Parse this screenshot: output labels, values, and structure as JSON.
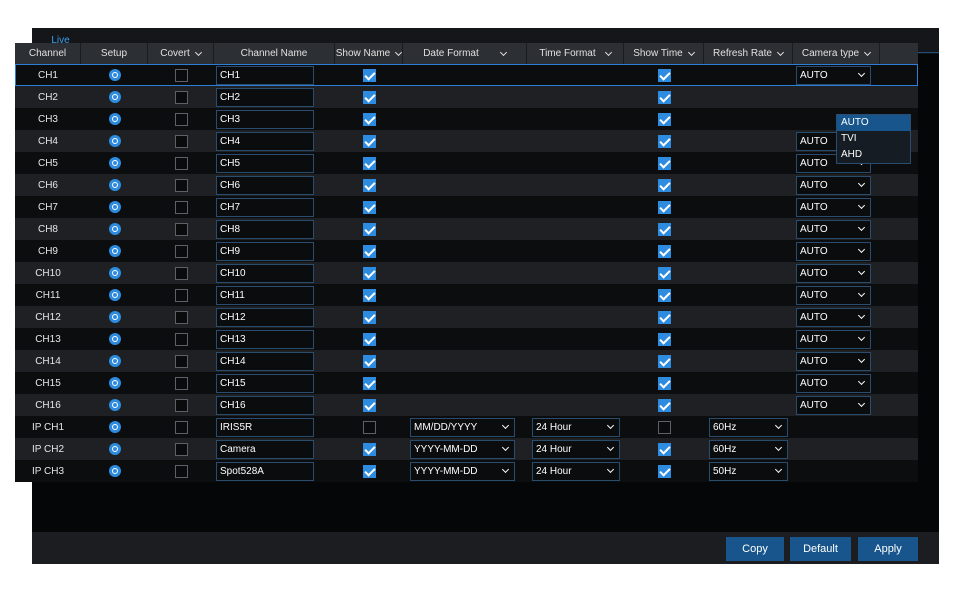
{
  "tabs": [
    {
      "label": "Live",
      "active": true
    }
  ],
  "columns": {
    "channel": "Channel",
    "setup": "Setup",
    "covert": "Covert",
    "channel_name": "Channel Name",
    "show_name": "Show Name",
    "date_format": "Date Format",
    "time_format": "Time Format",
    "show_time": "Show Time",
    "refresh_rate": "Refresh Rate",
    "camera_type": "Camera type"
  },
  "rows": [
    {
      "channel": "CH1",
      "covert": false,
      "name": "CH1",
      "show_name": true,
      "date_format": "",
      "time_format": "",
      "show_time": true,
      "refresh_rate": "",
      "camera_type": "AUTO",
      "selected": true
    },
    {
      "channel": "CH2",
      "covert": false,
      "name": "CH2",
      "show_name": true,
      "date_format": "",
      "time_format": "",
      "show_time": true,
      "refresh_rate": "",
      "camera_type": ""
    },
    {
      "channel": "CH3",
      "covert": false,
      "name": "CH3",
      "show_name": true,
      "date_format": "",
      "time_format": "",
      "show_time": true,
      "refresh_rate": "",
      "camera_type": ""
    },
    {
      "channel": "CH4",
      "covert": false,
      "name": "CH4",
      "show_name": true,
      "date_format": "",
      "time_format": "",
      "show_time": true,
      "refresh_rate": "",
      "camera_type": "AUTO"
    },
    {
      "channel": "CH5",
      "covert": false,
      "name": "CH5",
      "show_name": true,
      "date_format": "",
      "time_format": "",
      "show_time": true,
      "refresh_rate": "",
      "camera_type": "AUTO"
    },
    {
      "channel": "CH6",
      "covert": false,
      "name": "CH6",
      "show_name": true,
      "date_format": "",
      "time_format": "",
      "show_time": true,
      "refresh_rate": "",
      "camera_type": "AUTO"
    },
    {
      "channel": "CH7",
      "covert": false,
      "name": "CH7",
      "show_name": true,
      "date_format": "",
      "time_format": "",
      "show_time": true,
      "refresh_rate": "",
      "camera_type": "AUTO"
    },
    {
      "channel": "CH8",
      "covert": false,
      "name": "CH8",
      "show_name": true,
      "date_format": "",
      "time_format": "",
      "show_time": true,
      "refresh_rate": "",
      "camera_type": "AUTO"
    },
    {
      "channel": "CH9",
      "covert": false,
      "name": "CH9",
      "show_name": true,
      "date_format": "",
      "time_format": "",
      "show_time": true,
      "refresh_rate": "",
      "camera_type": "AUTO"
    },
    {
      "channel": "CH10",
      "covert": false,
      "name": "CH10",
      "show_name": true,
      "date_format": "",
      "time_format": "",
      "show_time": true,
      "refresh_rate": "",
      "camera_type": "AUTO"
    },
    {
      "channel": "CH11",
      "covert": false,
      "name": "CH11",
      "show_name": true,
      "date_format": "",
      "time_format": "",
      "show_time": true,
      "refresh_rate": "",
      "camera_type": "AUTO"
    },
    {
      "channel": "CH12",
      "covert": false,
      "name": "CH12",
      "show_name": true,
      "date_format": "",
      "time_format": "",
      "show_time": true,
      "refresh_rate": "",
      "camera_type": "AUTO"
    },
    {
      "channel": "CH13",
      "covert": false,
      "name": "CH13",
      "show_name": true,
      "date_format": "",
      "time_format": "",
      "show_time": true,
      "refresh_rate": "",
      "camera_type": "AUTO"
    },
    {
      "channel": "CH14",
      "covert": false,
      "name": "CH14",
      "show_name": true,
      "date_format": "",
      "time_format": "",
      "show_time": true,
      "refresh_rate": "",
      "camera_type": "AUTO"
    },
    {
      "channel": "CH15",
      "covert": false,
      "name": "CH15",
      "show_name": true,
      "date_format": "",
      "time_format": "",
      "show_time": true,
      "refresh_rate": "",
      "camera_type": "AUTO"
    },
    {
      "channel": "CH16",
      "covert": false,
      "name": "CH16",
      "show_name": true,
      "date_format": "",
      "time_format": "",
      "show_time": true,
      "refresh_rate": "",
      "camera_type": "AUTO"
    },
    {
      "channel": "IP CH1",
      "covert": false,
      "name": "IRIS5R",
      "show_name": false,
      "date_format": "MM/DD/YYYY",
      "time_format": "24 Hour",
      "show_time": false,
      "refresh_rate": "60Hz",
      "camera_type": ""
    },
    {
      "channel": "IP CH2",
      "covert": false,
      "name": "Camera",
      "show_name": true,
      "date_format": "YYYY-MM-DD",
      "time_format": "24 Hour",
      "show_time": true,
      "refresh_rate": "60Hz",
      "camera_type": ""
    },
    {
      "channel": "IP CH3",
      "covert": false,
      "name": "Spot528A",
      "show_name": true,
      "date_format": "YYYY-MM-DD",
      "time_format": "24 Hour",
      "show_time": true,
      "refresh_rate": "50Hz",
      "camera_type": ""
    }
  ],
  "camera_type_dropdown": {
    "options": [
      "AUTO",
      "TVI",
      "AHD"
    ],
    "highlighted": "AUTO"
  },
  "footer": {
    "copy_label": "Copy",
    "default_label": "Default",
    "apply_label": "Apply"
  },
  "colors": {
    "accent": "#2d8ce0",
    "button": "#17558c",
    "header_bg": "#2c2f33"
  }
}
